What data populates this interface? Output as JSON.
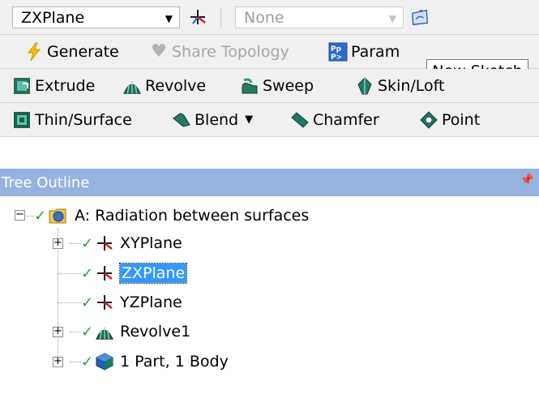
{
  "toolbar1": {
    "plane_value": "ZXPlane",
    "sketch_value": "None"
  },
  "toolbar2": {
    "generate_label": "Generate",
    "share_topology_label": "Share Topology",
    "parameters_label": "Param"
  },
  "tooltip": {
    "text": "New Sketch"
  },
  "toolbar3": {
    "extrude_label": "Extrude",
    "revolve_label": "Revolve",
    "sweep_label": "Sweep",
    "skin_loft_label": "Skin/Loft"
  },
  "toolbar4": {
    "thin_surface_label": "Thin/Surface",
    "blend_label": "Blend",
    "chamfer_label": "Chamfer",
    "point_label": "Point"
  },
  "tree": {
    "title": "Tree Outline",
    "root_label": "A: Radiation between surfaces",
    "children": [
      {
        "label": "XYPlane",
        "expandable": true,
        "icon": "plane-axes-icon"
      },
      {
        "label": "ZXPlane",
        "expandable": false,
        "selected": true,
        "icon": "plane-axes-icon"
      },
      {
        "label": "YZPlane",
        "expandable": false,
        "icon": "plane-axes-icon"
      },
      {
        "label": "Revolve1",
        "expandable": true,
        "icon": "revolve-icon"
      },
      {
        "label": "1 Part, 1 Body",
        "expandable": true,
        "icon": "part-body-icon"
      }
    ]
  },
  "colors": {
    "toolbar_bg": "#f0f0f0",
    "panel_header_bg": "#95b3e0",
    "selection_bg": "#3399ff",
    "check_green": "#21a531"
  }
}
